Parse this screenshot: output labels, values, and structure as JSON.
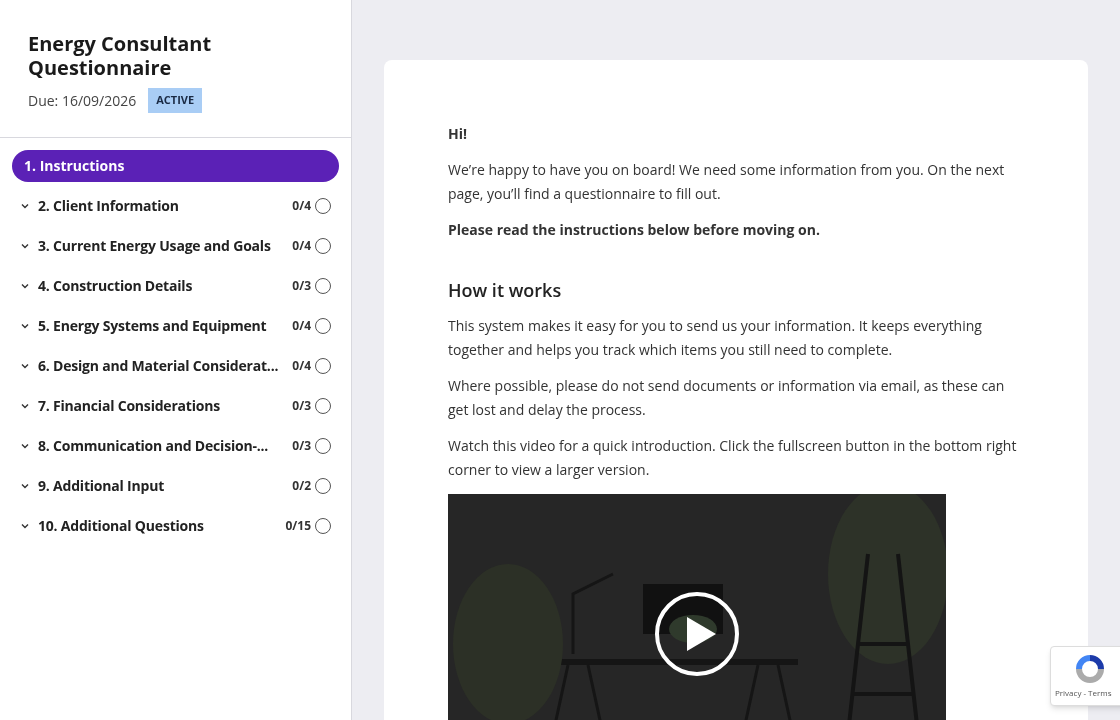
{
  "sidebar": {
    "title": "Energy Consultant Questionnaire",
    "due": "Due: 16/09/2026",
    "status": "ACTIVE",
    "items": [
      {
        "label": "1. Instructions",
        "selected": true
      },
      {
        "label": "2. Client Information",
        "count": "0/4",
        "selected": false,
        "done": false
      },
      {
        "label": "3. Current Energy Usage and Goals",
        "count": "0/4",
        "selected": false,
        "done": false
      },
      {
        "label": "4. Construction Details",
        "count": "0/3",
        "selected": false,
        "done": false
      },
      {
        "label": "5. Energy Systems and Equipment",
        "count": "0/4",
        "selected": false,
        "done": false
      },
      {
        "label": "6. Design and Material Considerat...",
        "count": "0/4",
        "selected": false,
        "done": false
      },
      {
        "label": "7. Financial Considerations",
        "count": "0/3",
        "selected": false,
        "done": false
      },
      {
        "label": "8. Communication and Decision-...",
        "count": "0/3",
        "selected": false,
        "done": false
      },
      {
        "label": "9. Additional Input",
        "count": "0/2",
        "selected": false,
        "done": false
      },
      {
        "label": "10. Additional Questions",
        "count": "0/15",
        "selected": false,
        "done": false
      }
    ]
  },
  "content": {
    "blocks": [
      {
        "kind": "strong",
        "text": "Hi!"
      },
      {
        "kind": "paragraph",
        "text": "We’re happy to have you on board! We need some information from you. On the next page, you’ll find a questionnaire to fill out."
      },
      {
        "kind": "strong",
        "text": "Please read the instructions below before moving on."
      },
      {
        "kind": "heading",
        "text": "How it works"
      },
      {
        "kind": "paragraph",
        "text": "This system makes it easy for you to send us your information. It keeps everything together and helps you track which items you still need to complete."
      },
      {
        "kind": "paragraph",
        "text": "Where possible, please do not send documents or information via email, as these can get lost and delay the process."
      },
      {
        "kind": "paragraph",
        "text": "Watch this video for a quick introduction. Click the fullscreen button in the bottom right corner to view a larger version."
      },
      {
        "kind": "video"
      }
    ]
  },
  "recaptcha": {
    "links": "Privacy - Terms"
  }
}
